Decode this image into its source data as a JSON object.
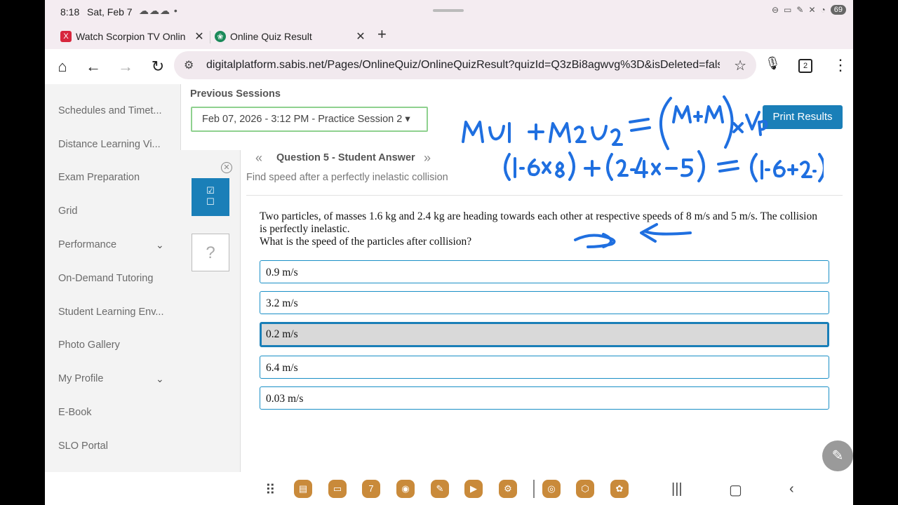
{
  "status": {
    "time": "8:18",
    "date": "Sat, Feb 7",
    "notifications": "☁☁☁ •",
    "battery": "69"
  },
  "tabs": [
    {
      "title": "Watch Scorpion TV Online | F",
      "favicon": "X",
      "close": "✕"
    },
    {
      "title": "Online Quiz Result",
      "favicon": "❀",
      "close": "✕"
    }
  ],
  "newtab": "+",
  "toolbar": {
    "url": "digitalplatform.sabis.net/Pages/OnlineQuiz/OnlineQuizResult?quizId=Q3zBi8agwvg%3D&isDeleted=false&",
    "tab_count": "2"
  },
  "sidebar": {
    "items": [
      {
        "label": "Schedules and Timet..."
      },
      {
        "label": "Distance Learning Vi..."
      },
      {
        "label": "Exam Preparation"
      },
      {
        "label": "Grid"
      },
      {
        "label": "Performance",
        "expandable": true
      },
      {
        "label": "On-Demand Tutoring"
      },
      {
        "label": "Student Learning Env..."
      },
      {
        "label": "Photo Gallery"
      },
      {
        "label": "My Profile",
        "expandable": true
      },
      {
        "label": "E-Book"
      },
      {
        "label": "SLO Portal"
      }
    ]
  },
  "main": {
    "previous_sessions_label": "Previous Sessions",
    "session_selected": "Feb 07, 2026 - 3:12 PM - Practice Session 2 ▾",
    "print_button": "Print Results",
    "question_title": "Question 5 - Student Answer",
    "question_subtitle": "Find speed after a perfectly inelastic collision",
    "question_text_1": "Two particles, of masses 1.6 kg and 2.4 kg are heading towards each other at respective speeds of 8 m/s and 5 m/s. The collision is perfectly inelastic.",
    "question_text_2": "What is the speed of the particles after collision?",
    "unknown_marker": "?",
    "options": [
      {
        "label": "0.9 m/s",
        "selected": false
      },
      {
        "label": "3.2 m/s",
        "selected": false
      },
      {
        "label": "0.2 m/s",
        "selected": true
      },
      {
        "label": "6.4 m/s",
        "selected": false
      },
      {
        "label": "0.03 m/s",
        "selected": false
      }
    ]
  },
  "colors": {
    "accent": "#1a7fb8",
    "handwriting": "#1f6fe0"
  }
}
